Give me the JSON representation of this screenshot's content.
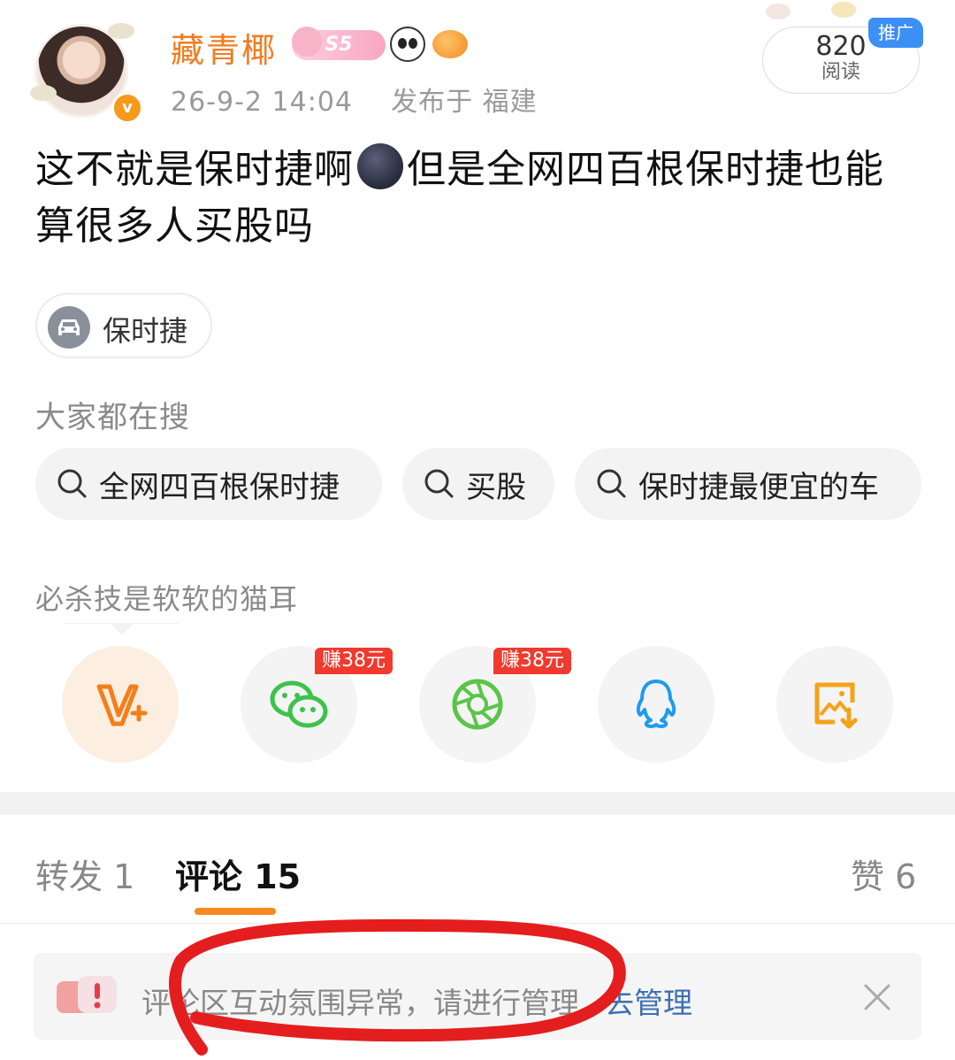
{
  "post": {
    "author": "藏青椰",
    "badge_text": "S5",
    "timestamp": "26-9-2 14:04",
    "location": "发布于 福建",
    "text_part1": "这不就是保时捷啊",
    "text_part2": "但是全网四百根保时捷也能算很多人买股吗",
    "topic": "保时捷"
  },
  "stats_box": {
    "count": "820",
    "label": "阅读",
    "promo_tag": "推广"
  },
  "search": {
    "section_title": "大家都在搜",
    "chips": [
      "全网四百根保时捷",
      "买股",
      "保时捷最便宜的车"
    ]
  },
  "share": {
    "hint": "必杀技是软软的猫耳",
    "earn_tags": [
      "赚38元",
      "赚38元"
    ],
    "icons": [
      "weibo-v-plus-icon",
      "wechat-icon",
      "moments-icon",
      "qq-icon",
      "save-image-icon"
    ]
  },
  "tabs": {
    "repost": "转发 1",
    "comments": "评论 15",
    "likes": "赞 6"
  },
  "notice": {
    "message": "评论区互动氛围异常，请进行管理",
    "action": "去管理"
  },
  "colors": {
    "accent": "#f7891e",
    "username": "#f07c1f",
    "link": "#3d6fb4",
    "earn_tag": "#f03a2e",
    "annotation": "#e41e1e"
  }
}
